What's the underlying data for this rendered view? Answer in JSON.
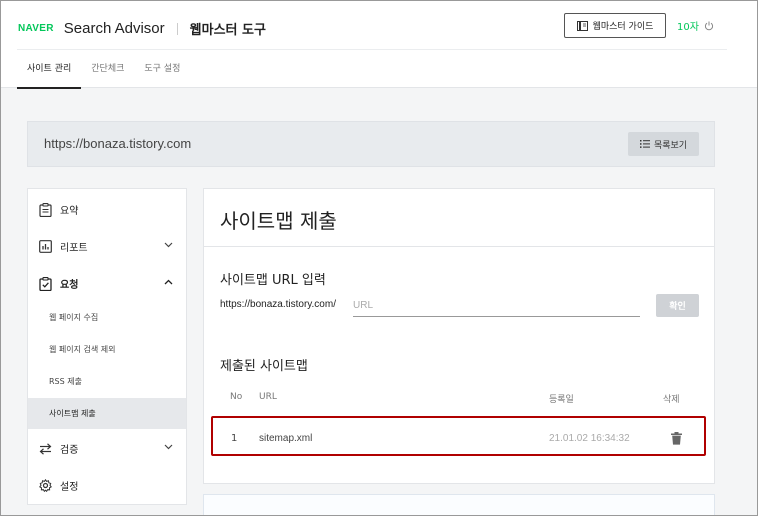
{
  "header": {
    "brand_naver": "NAVER",
    "brand_title": "Search Advisor",
    "tool_title": "웹마스터 도구",
    "guide_button": "웹마스터 가이드",
    "user_name": "10자"
  },
  "tabs": [
    {
      "label": "사이트 관리",
      "active": true
    },
    {
      "label": "간단체크",
      "active": false
    },
    {
      "label": "도구 설정",
      "active": false
    }
  ],
  "site": {
    "url": "https://bonaza.tistory.com",
    "list_button": "목록보기"
  },
  "sidebar": {
    "items": [
      {
        "label": "요약",
        "icon": "clipboard-icon"
      },
      {
        "label": "리포트",
        "icon": "chart-icon",
        "expandable": true,
        "expanded": false
      },
      {
        "label": "요청",
        "icon": "checklist-icon",
        "expandable": true,
        "expanded": true
      },
      {
        "label": "검증",
        "icon": "swap-icon",
        "expandable": true,
        "expanded": false
      },
      {
        "label": "설정",
        "icon": "gear-icon"
      }
    ],
    "sub_items": [
      {
        "label": "웹 페이지 수집",
        "active": false
      },
      {
        "label": "웹 페이지 검색 제외",
        "active": false
      },
      {
        "label": "RSS 제출",
        "active": false
      },
      {
        "label": "사이트맵 제출",
        "active": true
      }
    ]
  },
  "main": {
    "title": "사이트맵 제출",
    "input_section_label": "사이트맵 URL 입력",
    "url_prefix": "https://bonaza.tistory.com/",
    "url_placeholder": "URL",
    "url_value": "",
    "confirm_button": "확인",
    "submitted_label": "제출된 사이트맵",
    "table": {
      "columns": [
        "No",
        "URL",
        "등록일",
        "삭제"
      ],
      "rows": [
        {
          "no": "1",
          "url": "sitemap.xml",
          "date": "21.01.02 16:34:32"
        }
      ]
    }
  },
  "colors": {
    "brand_green": "#03c75a",
    "highlight_red": "#b00000",
    "sidebar_active_bg": "#e6e8eb"
  }
}
